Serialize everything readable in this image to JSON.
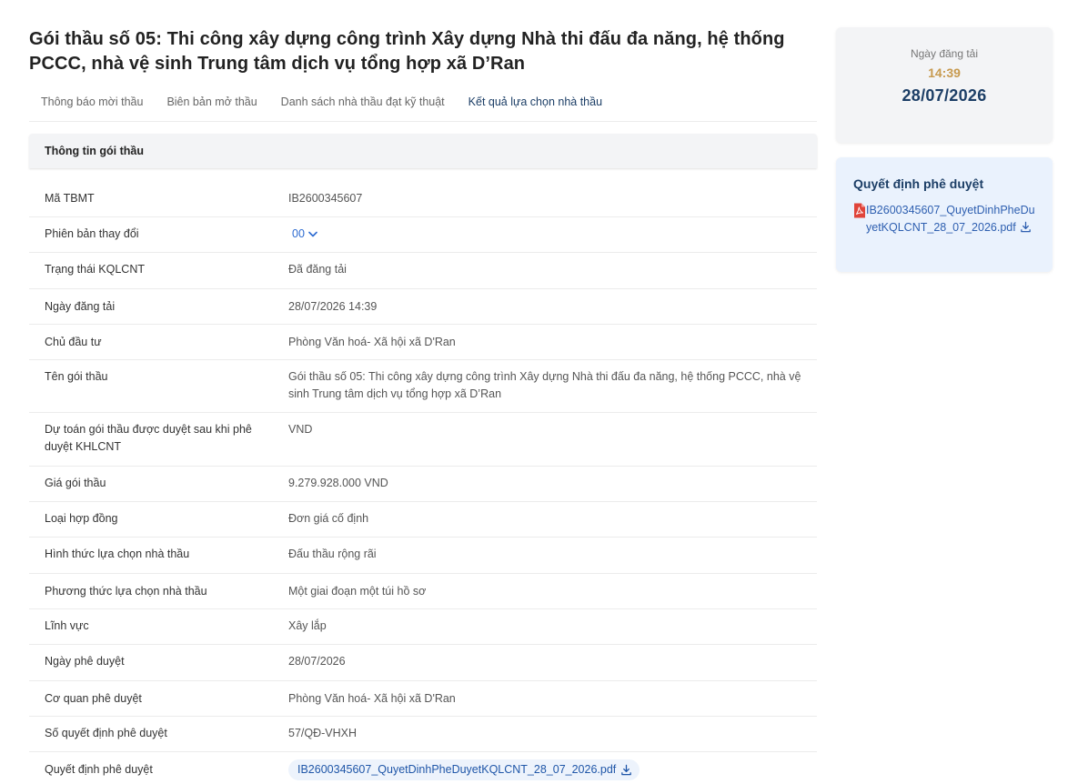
{
  "page": {
    "title": "Gói thầu số 05: Thi công xây dựng công trình Xây dựng Nhà thi đấu đa năng, hệ thống PCCC, nhà vệ sinh Trung tâm dịch vụ tổng hợp xã D’Ran"
  },
  "tabs": [
    {
      "label": "Thông báo mời thầu",
      "active": false
    },
    {
      "label": "Biên bản mở thầu",
      "active": false
    },
    {
      "label": "Danh sách nhà thầu đạt kỹ thuật",
      "active": false
    },
    {
      "label": "Kết quả lựa chọn nhà thầu",
      "active": true
    }
  ],
  "section": {
    "title": "Thông tin gói thầu"
  },
  "rows": [
    {
      "label": "Mã TBMT",
      "value": "IB2600345607"
    },
    {
      "label": "Phiên bản thay đổi",
      "value": "00"
    },
    {
      "label": "Trạng thái KQLCNT",
      "value": "Đã đăng tải"
    },
    {
      "label": "Ngày đăng tải",
      "value": "28/07/2026 14:39"
    },
    {
      "label": "Chủ đầu tư",
      "value": "Phòng Văn hoá- Xã hội xã D'Ran"
    },
    {
      "label": "Tên gói thầu",
      "value": "Gói thầu số 05: Thi công xây dựng công trình Xây dựng Nhà thi đấu đa năng, hệ thống PCCC, nhà vệ sinh Trung tâm dịch vụ tổng hợp xã D’Ran"
    },
    {
      "label": "Dự toán gói thầu được duyệt sau khi phê duyệt KHLCNT",
      "value": "VND"
    },
    {
      "label": "Giá gói thầu",
      "value": "9.279.928.000 VND"
    },
    {
      "label": "Loại hợp đồng",
      "value": "Đơn giá cố định"
    },
    {
      "label": "Hình thức lựa chọn nhà thầu",
      "value": "Đấu thầu rộng rãi"
    },
    {
      "label": "Phương thức lựa chọn nhà thầu",
      "value": "Một giai đoạn một túi hồ sơ"
    },
    {
      "label": "Lĩnh vực",
      "value": "Xây lắp"
    },
    {
      "label": "Ngày phê duyệt",
      "value": "28/07/2026"
    },
    {
      "label": "Cơ quan phê duyệt",
      "value": "Phòng Văn hoá- Xã hội xã D'Ran"
    },
    {
      "label": "Số quyết định phê duyệt",
      "value": "57/QĐ-VHXH"
    },
    {
      "label": "Quyết định phê duyệt",
      "value": "IB2600345607_QuyetDinhPheDuyetKQLCNT_28_07_2026.pdf"
    }
  ],
  "sidebar": {
    "posted_label": "Ngày đăng tải",
    "posted_time": "14:39",
    "posted_date": "28/07/2026",
    "decision_title": "Quyết định phê duyệt",
    "decision_file": "IB2600345607_QuyetDinhPheDuyetKQLCNT_28_07_2026.pdf"
  },
  "colors": {
    "accent_navy": "#1c3e66",
    "link_blue": "#2e6bd1",
    "time_gold": "#c79a4f",
    "pdf_red": "#e0443a"
  },
  "icons": [
    "chevron-down-icon",
    "download-icon",
    "pdf-icon"
  ]
}
